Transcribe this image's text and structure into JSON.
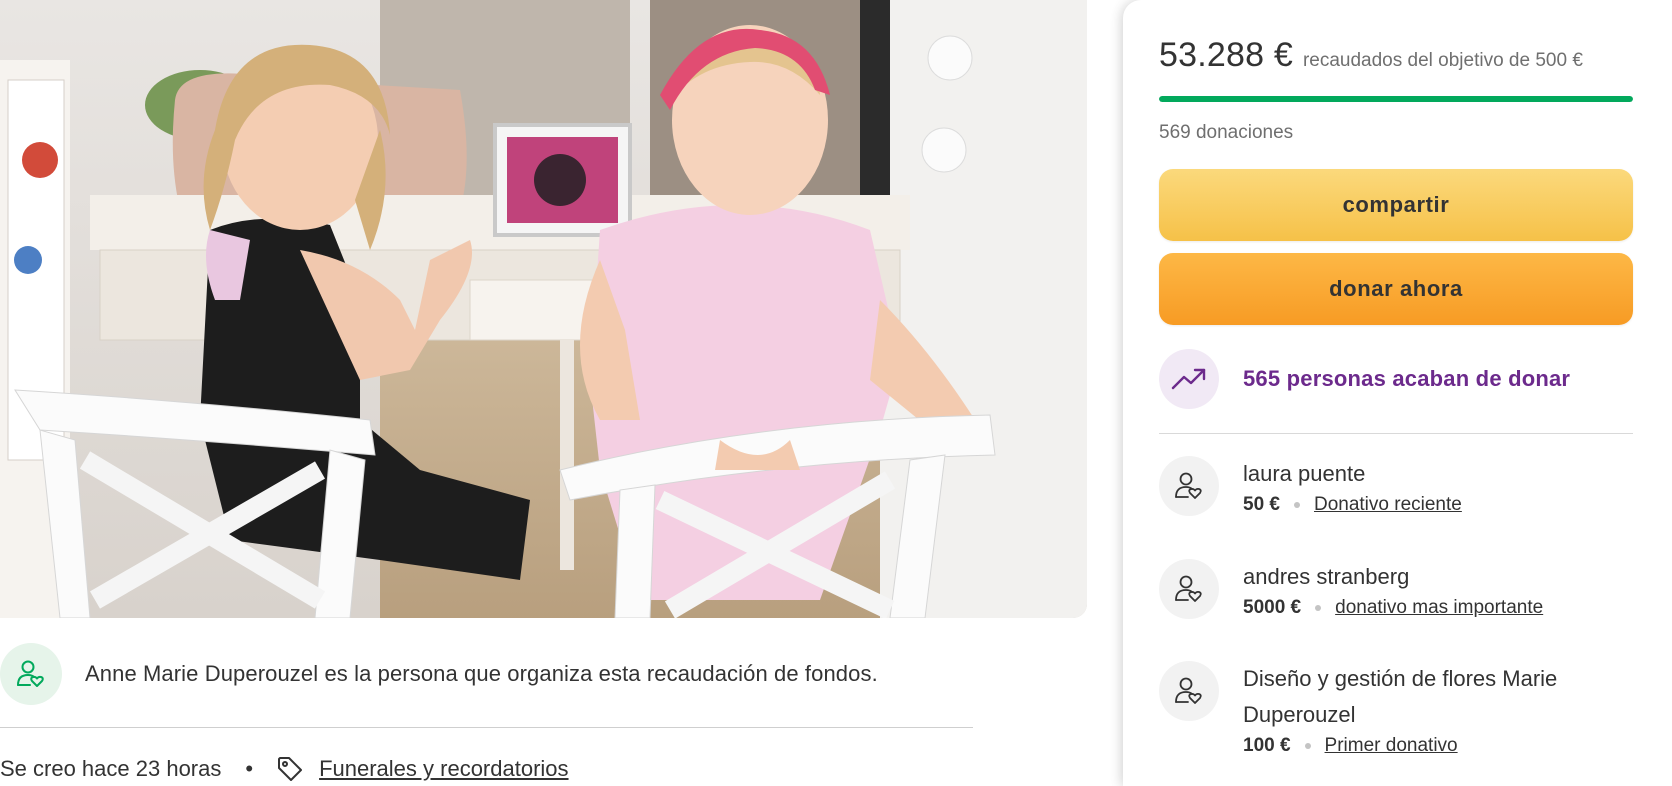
{
  "campaign": {
    "photo_alt": "",
    "organizer_text": "Anne Marie Duperouzel es la persona que organiza esta recaudación de fondos.",
    "created": "Se creo hace 23 horas",
    "separator": "•",
    "category": "Funerales y recordatorios"
  },
  "sidebar": {
    "raised": "53.288 €",
    "goal_text": "recaudados del objetivo de 500 €",
    "progress_fraction": 1.0,
    "donations": "569 donaciones",
    "share_label": "compartir",
    "donate_label": "donar ahora",
    "recent_activity": "565 personas acaban de donar",
    "donors": [
      {
        "name": "laura puente",
        "amount": "50 €",
        "tag": "Donativo reciente"
      },
      {
        "name": "andres stranberg",
        "amount": "5000 €",
        "tag": "donativo mas importante"
      },
      {
        "name": "Diseño y gestión de flores Marie Duperouzel",
        "amount": "100 €",
        "tag": "Primer donativo"
      }
    ]
  },
  "colors": {
    "progress": "#02a95c",
    "share_button": "#f6c148",
    "donate_button": "#f79b24",
    "activity_text": "#6c2a8c"
  },
  "icons": {
    "organizer": "person-heart-icon",
    "category": "tag-icon",
    "activity": "trending-up-icon",
    "donor": "person-heart-icon"
  }
}
